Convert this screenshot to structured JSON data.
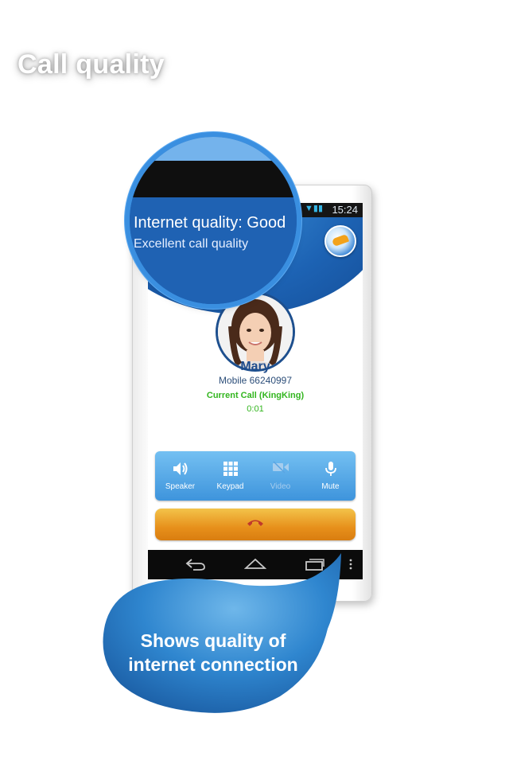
{
  "headline": "Call quality",
  "status_bar": {
    "time": "15:24"
  },
  "magnifier": {
    "quality_title": "Internet quality: Good",
    "quality_subtitle": "Excellent call quality"
  },
  "contact": {
    "name": "Mary",
    "number": "Mobile  66240997",
    "call_status": "Current Call (KingKing)",
    "timer": "0:01"
  },
  "controls": [
    {
      "label": "Speaker",
      "icon": "speaker-icon",
      "enabled": true
    },
    {
      "label": "Keypad",
      "icon": "keypad-icon",
      "enabled": true
    },
    {
      "label": "Video",
      "icon": "video-icon",
      "enabled": false
    },
    {
      "label": "Mute",
      "icon": "microphone-icon",
      "enabled": true
    }
  ],
  "end_call": {
    "icon": "end-call-icon",
    "color": "#e7901b"
  },
  "navbar": {
    "icons": [
      "back-icon",
      "home-icon",
      "recent-apps-icon",
      "overflow-menu-icon"
    ]
  },
  "callout": {
    "line1": "Shows quality of",
    "line2": "internet connection"
  },
  "colors": {
    "brand_blue": "#1e5fb0",
    "accent_green": "#33b61f",
    "bubble_blue": "#2f86cf"
  }
}
